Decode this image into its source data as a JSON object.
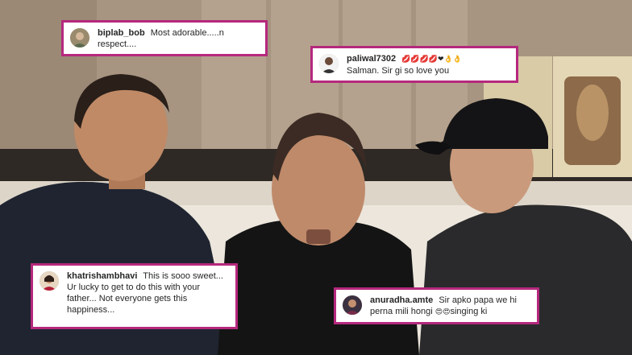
{
  "comments": [
    {
      "username": "biplab_bob",
      "text": "Most adorable.....n respect....",
      "avatar": "profile-avatar"
    },
    {
      "username": "paliwal7302",
      "text": "Salman. Sir gi so love you",
      "emojis": "💋💋💋💋❤👌👌",
      "avatar": "profile-avatar"
    },
    {
      "username": "khatrishambhavi",
      "text": "This is sooo sweet... Ur lucky to get to do this with your father... Not everyone gets this happiness...",
      "avatar": "profile-avatar"
    },
    {
      "username": "anuradha.amte",
      "text": "Sir apko papa we hi perna mili hongi",
      "emojis": "😍😍",
      "text_after": "singing ki",
      "avatar": "profile-avatar"
    }
  ],
  "colors": {
    "comment_border": "#b5287d",
    "comment_bg": "#ffffff",
    "text": "#262626"
  }
}
